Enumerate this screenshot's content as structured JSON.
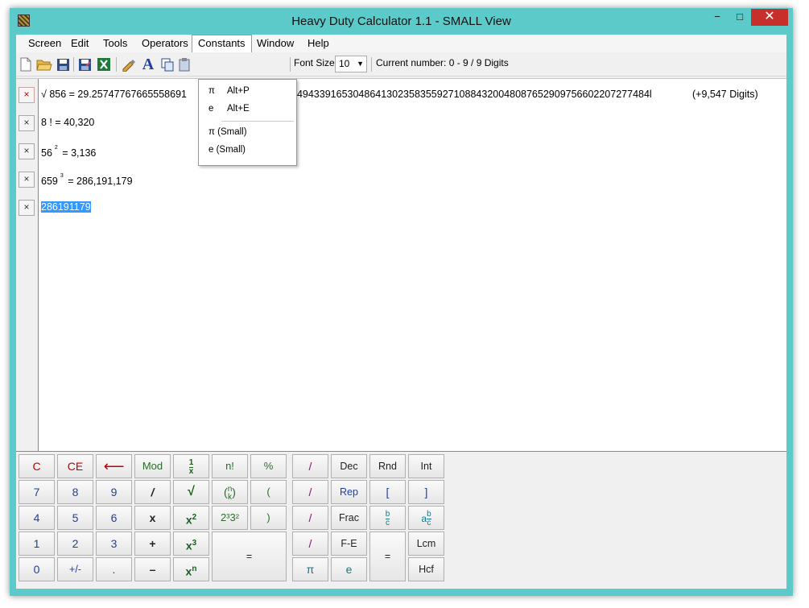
{
  "window": {
    "title": "Heavy Duty Calculator 1.1 - SMALL View",
    "minimize_label": "−",
    "maximize_label": "□",
    "close_label": "✕"
  },
  "menubar": {
    "items": [
      "Screen",
      "Edit",
      "Tools",
      "Operators",
      "Constants",
      "Window",
      "Help"
    ],
    "active": "Constants"
  },
  "constants_menu": {
    "items": [
      {
        "label": "π",
        "shortcut": "Alt+P"
      },
      {
        "label": "e",
        "shortcut": "Alt+E"
      },
      {
        "label": "π (Small)",
        "shortcut": ""
      },
      {
        "label": "e (Small)",
        "shortcut": ""
      }
    ]
  },
  "toolbar": {
    "font_size_label": "Font Size",
    "font_size_value": "10",
    "current_number": "Current number: 0 - 9 / 9 Digits",
    "icons": [
      "new-file-icon",
      "open-folder-icon",
      "save-icon",
      "save-as-icon",
      "excel-icon",
      "paint-icon",
      "font-icon",
      "copy-icon",
      "paste-icon"
    ]
  },
  "history": {
    "remove_label": "×",
    "lines": [
      {
        "pre": "√ 856 = 29.25747767665558691",
        "post": "1494339165304864130235835592710884320048087652909756602207277484l",
        "digits": "(+9,547 Digits)"
      },
      {
        "text": "8 ! = 40,320"
      },
      {
        "base": "56",
        "exp": "2",
        "result": "= 3,136"
      },
      {
        "base": "659",
        "exp": "3",
        "result": "= 286,191,179"
      },
      {
        "selected": "286191179"
      }
    ]
  },
  "keypad": {
    "row1": [
      "C",
      "CE",
      "⟵",
      "Mod",
      "1/x",
      "n!",
      "%",
      "/",
      "Dec",
      "Rnd",
      "Int"
    ],
    "row2": [
      "7",
      "8",
      "9",
      "/",
      "√",
      "(n k)",
      "(",
      "/",
      "Rep",
      "[",
      "]"
    ],
    "row3": [
      "4",
      "5",
      "6",
      "x",
      "x²",
      "2³3²",
      ")",
      "/",
      "Frac",
      "b/c",
      "a b/c"
    ],
    "row4": [
      "1",
      "2",
      "3",
      "+",
      "x³",
      "=",
      "/",
      "F-E",
      "=",
      "Lcm"
    ],
    "row5": [
      "0",
      "+/-",
      ".",
      "–",
      "xⁿ",
      "π",
      "e",
      "Hcf"
    ]
  }
}
